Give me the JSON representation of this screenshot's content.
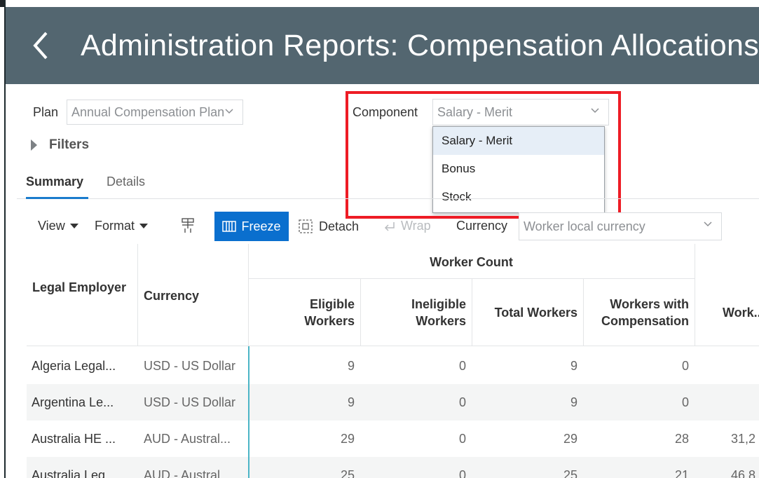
{
  "header": {
    "title": "Administration Reports: Compensation Allocations"
  },
  "plan": {
    "label": "Plan",
    "value": "Annual Compensation Plan"
  },
  "filters": {
    "label": "Filters"
  },
  "component": {
    "label": "Component",
    "value": "Salary - Merit",
    "options": [
      "Salary - Merit",
      "Bonus",
      "Stock"
    ]
  },
  "tabs": [
    {
      "label": "Summary"
    },
    {
      "label": "Details"
    }
  ],
  "toolbar": {
    "view": "View",
    "format": "Format",
    "freeze": "Freeze",
    "detach": "Detach",
    "wrap": "Wrap",
    "currency_label": "Currency",
    "currency_value": "Worker local currency"
  },
  "table": {
    "headers": {
      "legal_employer": "Legal Employer",
      "currency": "Currency",
      "group": "Worker Count",
      "eligible": "Eligible Workers",
      "ineligible": "Ineligible Workers",
      "total": "Total Workers",
      "with_comp": "Workers with Compensation",
      "partial": "Work... Am..."
    },
    "rows": [
      {
        "employer": "Algeria Legal...",
        "currency": "USD - US Dollar",
        "eligible": "9",
        "ineligible": "0",
        "total": "9",
        "with_comp": "0",
        "amount": ""
      },
      {
        "employer": "Argentina Le...",
        "currency": "USD - US Dollar",
        "eligible": "9",
        "ineligible": "0",
        "total": "9",
        "with_comp": "0",
        "amount": ""
      },
      {
        "employer": "Australia HE ...",
        "currency": "AUD - Austral...",
        "eligible": "29",
        "ineligible": "0",
        "total": "29",
        "with_comp": "28",
        "amount": "31,2"
      },
      {
        "employer": "Australia Leg...",
        "currency": "AUD - Austral...",
        "eligible": "25",
        "ineligible": "0",
        "total": "25",
        "with_comp": "21",
        "amount": "46,8"
      }
    ]
  },
  "colors": {
    "header_bg": "#536670",
    "accent": "#0a6fce",
    "highlight": "#ee1c25",
    "freeze_line": "#4bb5c6"
  }
}
